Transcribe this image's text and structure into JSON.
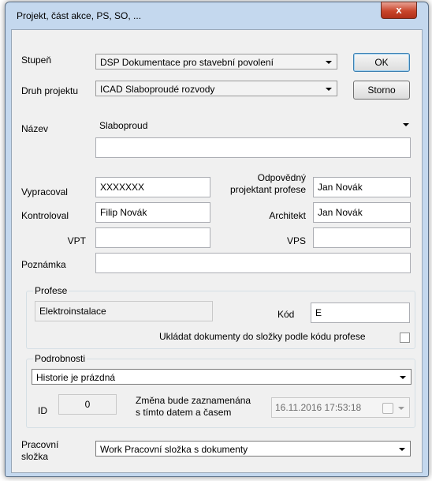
{
  "window": {
    "title": "Projekt, část akce, PS, SO, ...",
    "close_label": "x"
  },
  "buttons": {
    "ok": "OK",
    "cancel": "Storno"
  },
  "stupen": {
    "label": "Stupeň",
    "value": "DSP Dokumentace pro stavební povolení"
  },
  "druh": {
    "label": "Druh projektu",
    "value": "ICAD Slaboproudé rozvody"
  },
  "nazev": {
    "label": "Název",
    "value": "Slaboproud",
    "second_line": ""
  },
  "people": {
    "vypracoval_label": "Vypracoval",
    "vypracoval": "XXXXXXX",
    "zodpovedny_label_1": "Odpovědný",
    "zodpovedny_label_2": "projektant profese",
    "zodpovedny": "Jan Novák",
    "kontroloval_label": "Kontroloval",
    "kontroloval": "Filip Novák",
    "architekt_label": "Architekt",
    "architekt": "Jan Novák",
    "vpt_label": "VPT",
    "vpt": "",
    "vps_label": "VPS",
    "vps": ""
  },
  "poznamka": {
    "label": "Poznámka",
    "value": ""
  },
  "profese": {
    "group_label": "Profese",
    "name": "Elektroinstalace",
    "kod_label": "Kód",
    "kod": "E",
    "checkbox_label": "Ukládat dokumenty do složky podle kódu profese",
    "checked": false
  },
  "podrobnosti": {
    "group_label": "Podrobnosti",
    "history": "Historie je prázdná",
    "id_label": "ID",
    "id": "0",
    "change_label_1": "Změna bude zaznamenána",
    "change_label_2": "s tímto datem a časem",
    "datetime": "16.11.2016   17:53:18"
  },
  "pracovni": {
    "label_1": "Pracovní",
    "label_2": "složka",
    "value": "Work   Pracovní složka s dokumenty"
  }
}
